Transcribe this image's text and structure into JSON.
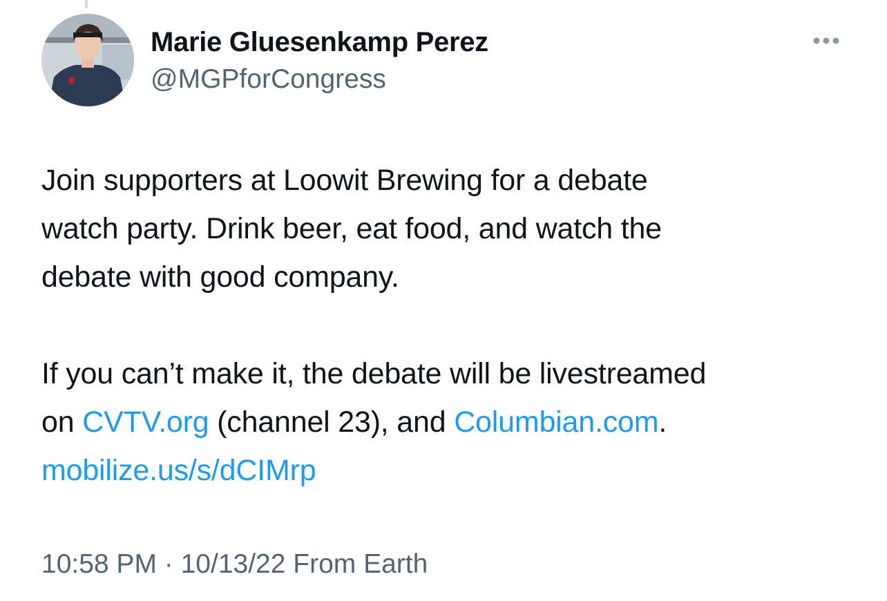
{
  "tweet": {
    "author_name": "Marie Gluesenkamp Perez",
    "author_handle": "@MGPforCongress",
    "paragraph1": {
      "line1": "Join supporters at Loowit Brewing for a debate",
      "line2": "watch party. Drink beer, eat food, and watch the",
      "line3": "debate with good company."
    },
    "paragraph2": {
      "line1": "If you can’t make it, the debate will be livestreamed",
      "on": "on ",
      "link_cvtv": "CVTV.org",
      "channel": " (channel 23), and ",
      "link_columbian": "Columbian.com",
      "period": ".",
      "link_mobilize": "mobilize.us/s/dCIMrp"
    },
    "time": "10:58 PM",
    "separator": " · ",
    "date": "10/13/22",
    "source": " From Earth"
  },
  "icons": {
    "more": "more-horizontal-icon",
    "avatar": "profile-photo"
  },
  "colors": {
    "link": "#1d9bf0",
    "secondary_text": "#536471",
    "primary_text": "#0f1419"
  }
}
